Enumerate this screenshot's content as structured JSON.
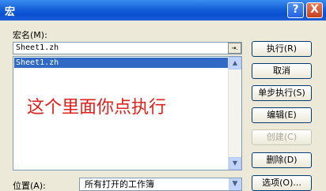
{
  "window": {
    "title": "宏"
  },
  "titlebar": {
    "help_label": "?",
    "close_label": "X"
  },
  "macro_name": {
    "label": "宏名(M):",
    "value": "Sheet1.zh",
    "browse_label": "⇥."
  },
  "macro_list": {
    "items": [
      "Sheet1.zh"
    ],
    "selected": "Sheet1.zh"
  },
  "annotation": {
    "text": "这个里面你点执行",
    "color": "#e0201c"
  },
  "buttons": {
    "run": "执行(R)",
    "cancel": "取消",
    "step": "单步执行(S)",
    "edit": "编辑(E)",
    "create": "创建(C)",
    "delete": "删除(D)",
    "options": "选项(O)..."
  },
  "location": {
    "label": "位置(A):",
    "value": "所有打开的工作簿"
  },
  "icons": {
    "scroll_up": "▲",
    "scroll_down": "▼",
    "combo_arrow": "▼"
  }
}
